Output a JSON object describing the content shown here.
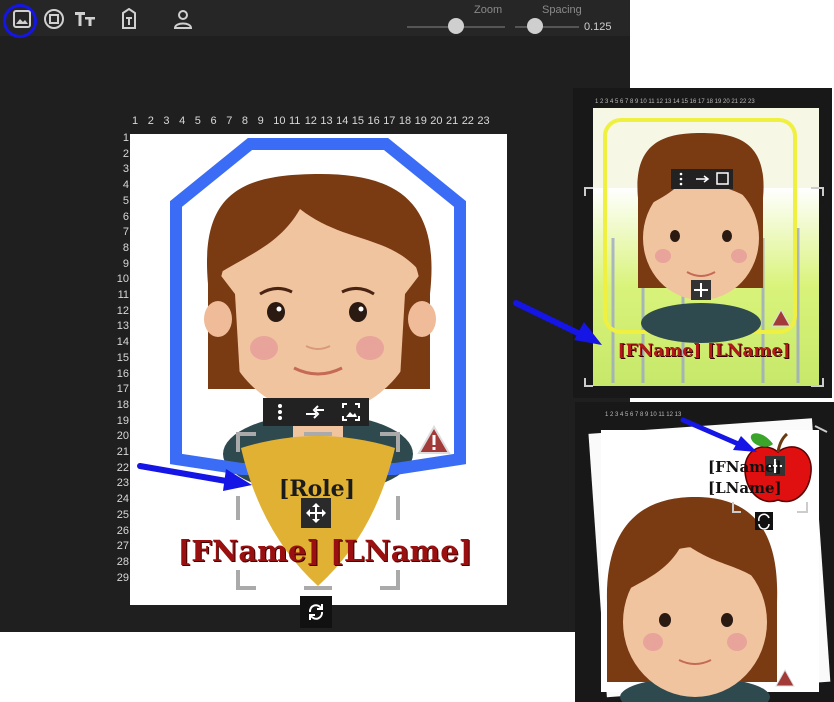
{
  "toolbar": {
    "tools": [
      {
        "name": "image-tool",
        "selected": true
      },
      {
        "name": "frame-tool"
      },
      {
        "name": "text-tool"
      },
      {
        "name": "text-field-tool"
      },
      {
        "name": "person-tool"
      }
    ],
    "zoom_label": "Zoom",
    "spacing_label": "Spacing",
    "spacing_value": "0.125",
    "zoom_level": 0.5,
    "spacing_level": 0.25
  },
  "ruler": {
    "columns": [
      "1",
      "2",
      "3",
      "4",
      "5",
      "6",
      "7",
      "8",
      "9",
      "10",
      "11",
      "12",
      "13",
      "14",
      "15",
      "16",
      "17",
      "18",
      "19",
      "20",
      "21",
      "22",
      "23"
    ],
    "rows": [
      "1",
      "2",
      "3",
      "4",
      "5",
      "6",
      "7",
      "8",
      "9",
      "10",
      "11",
      "12",
      "13",
      "14",
      "15",
      "16",
      "17",
      "18",
      "19",
      "20",
      "21",
      "22",
      "23",
      "24",
      "25",
      "26",
      "27",
      "28",
      "29"
    ]
  },
  "card": {
    "role_text": "[Role]",
    "name_text": "[FName] [LName]",
    "frame_color": "#3a6cf5",
    "badge_color": "#e0b132",
    "name_color": "#9a1010"
  },
  "preview_1": {
    "name_text": "[FName] [LName]",
    "frame_color": "#f0f040"
  },
  "preview_2": {
    "name_line1": "[FName]",
    "name_line2": "[LName]"
  },
  "icons": [
    "image-icon",
    "frame-icon",
    "text-icon",
    "text-field-icon",
    "person-icon",
    "more-vert-icon",
    "swap-icon",
    "photo-fit-icon",
    "move-icon",
    "rotate-icon",
    "warning-icon",
    "arrow-icon",
    "apple-icon"
  ]
}
